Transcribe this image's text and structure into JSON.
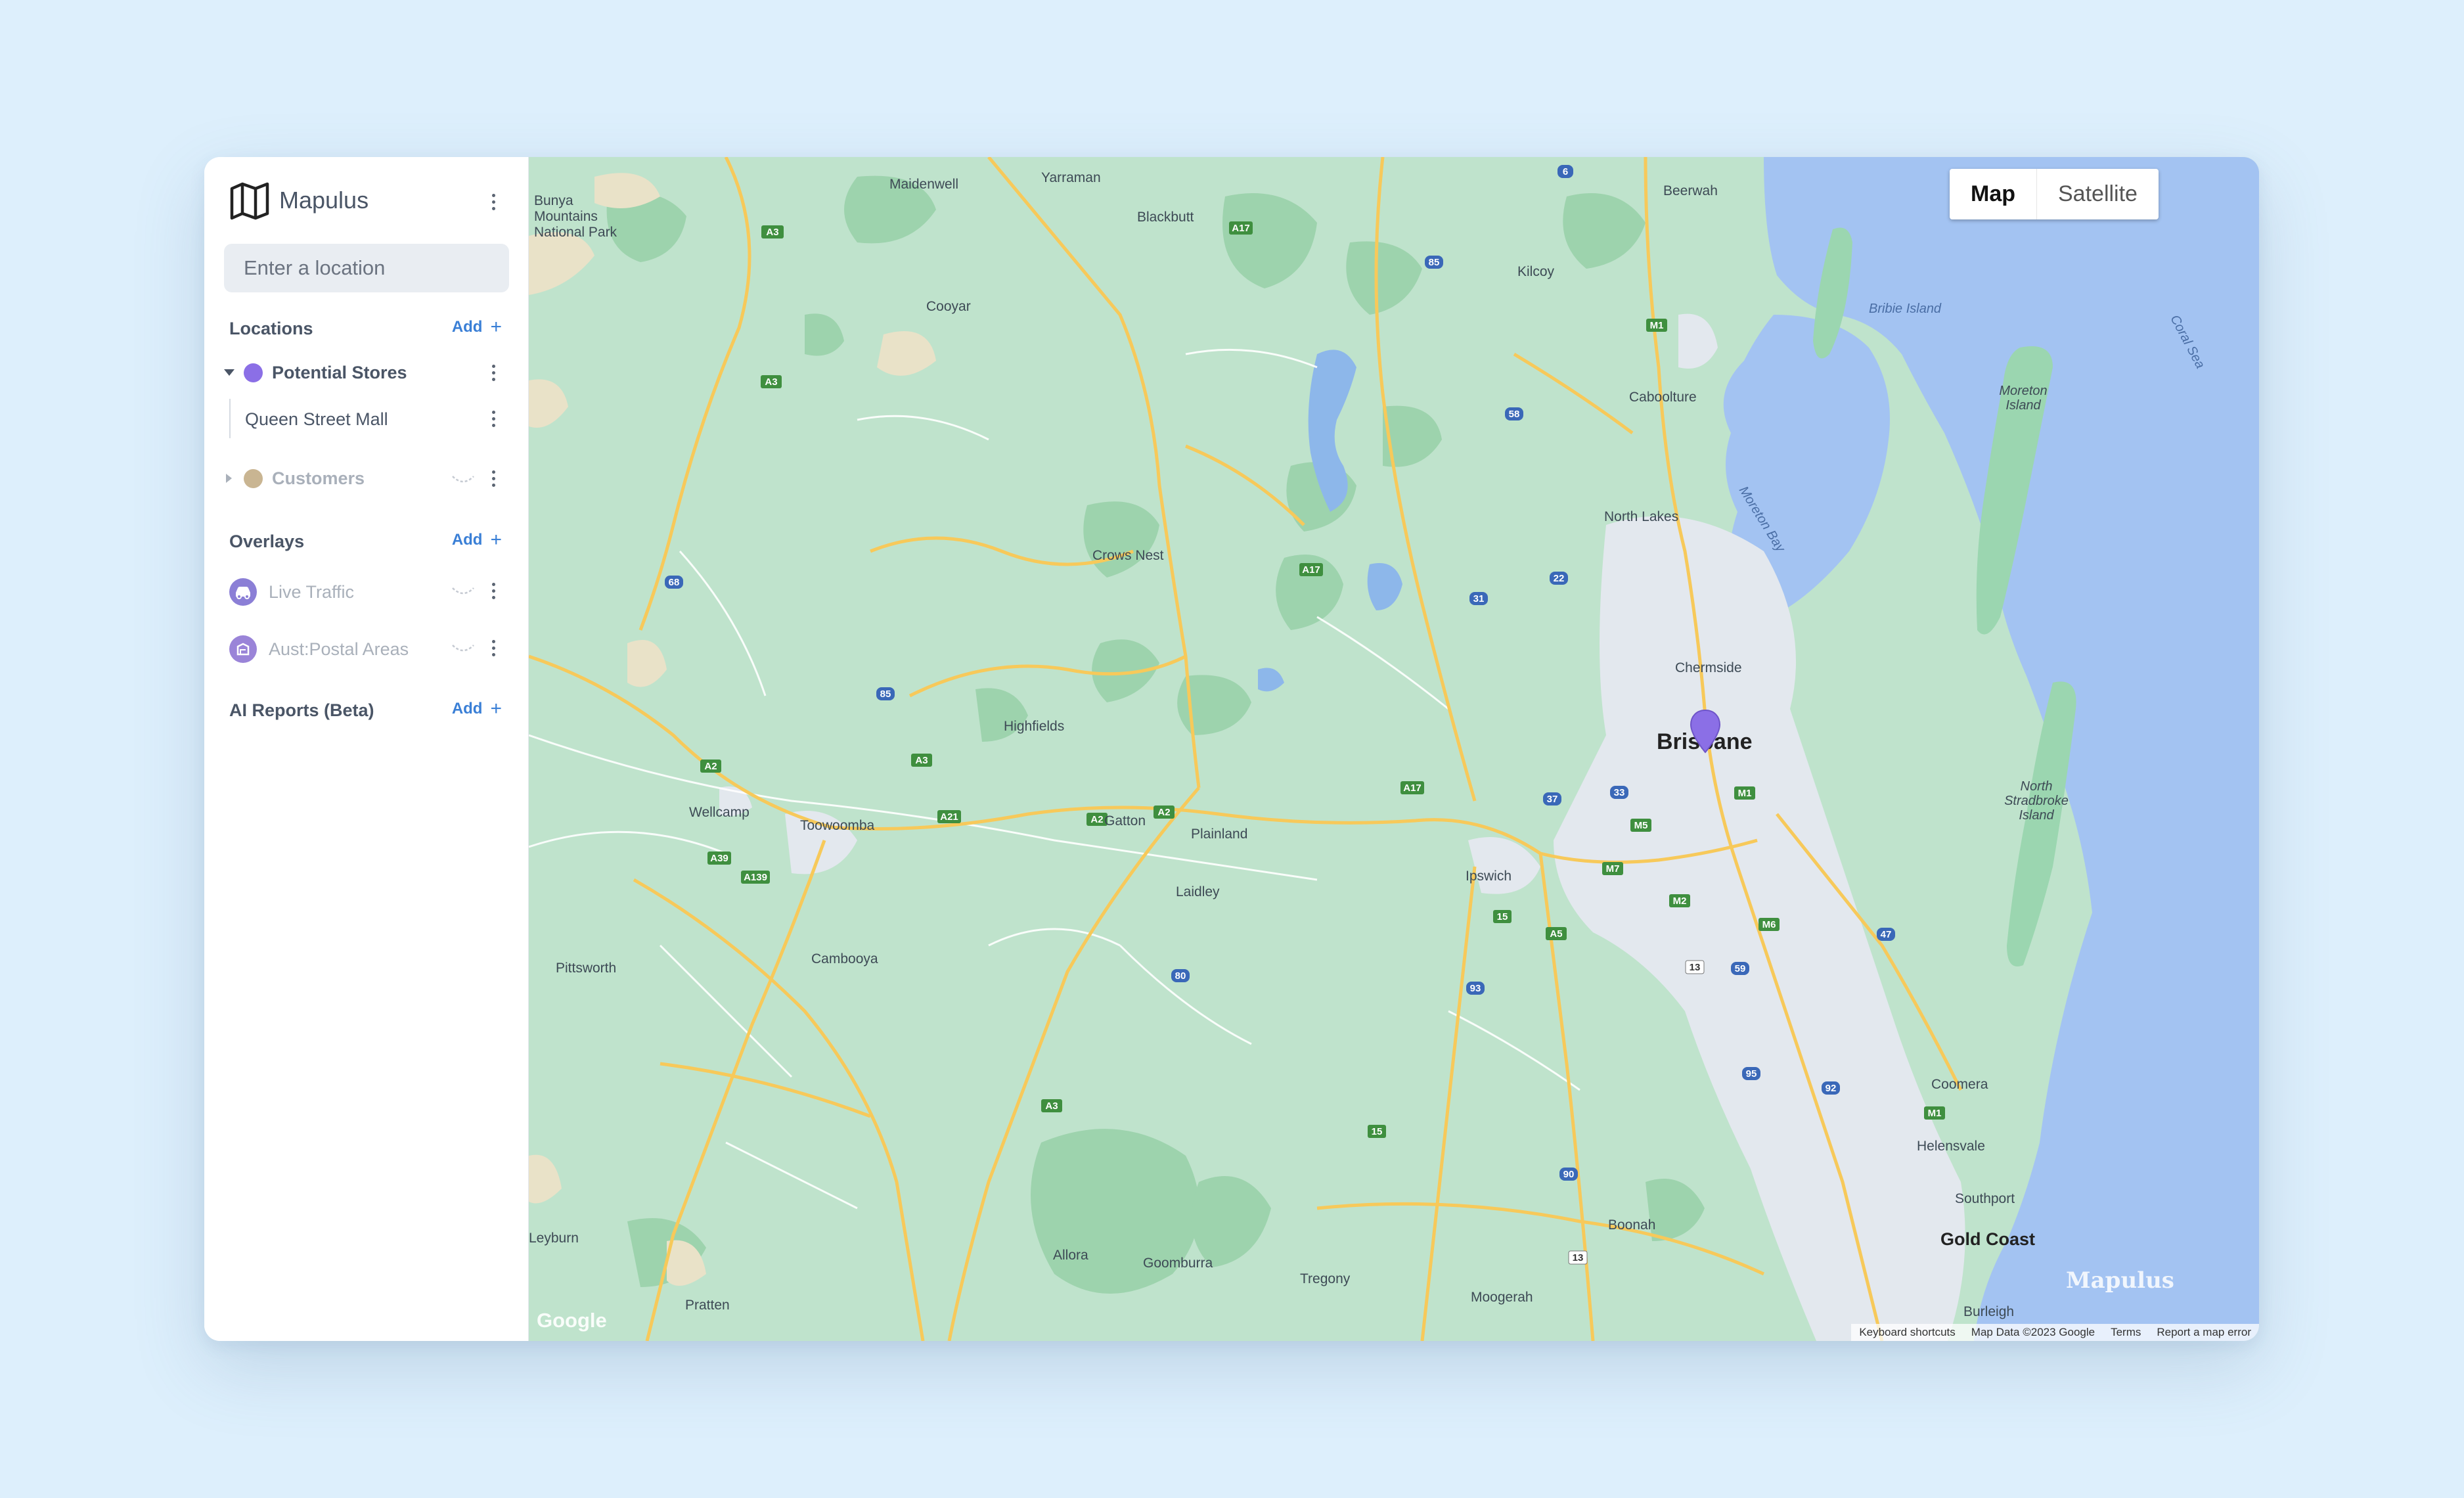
{
  "app": {
    "name": "Mapulus"
  },
  "search": {
    "placeholder": "Enter a location",
    "value": ""
  },
  "sections": {
    "locations": {
      "title": "Locations",
      "add_label": "Add"
    },
    "overlays": {
      "title": "Overlays",
      "add_label": "Add"
    },
    "ai_reports": {
      "title": "AI Reports (Beta)",
      "add_label": "Add"
    }
  },
  "locations": [
    {
      "name": "Potential Stores",
      "color": "#8b6fe6",
      "expanded": true,
      "children": [
        "Queen Street Mall"
      ]
    },
    {
      "name": "Customers",
      "color": "#c9b592",
      "expanded": false,
      "children": []
    }
  ],
  "overlays": [
    {
      "name": "Live Traffic",
      "icon": "car-icon"
    },
    {
      "name": "Aust:Postal Areas",
      "icon": "polygon-icon"
    }
  ],
  "map": {
    "type_options": [
      "Map",
      "Satellite"
    ],
    "selected_type": "Map",
    "watermark": "Mapulus",
    "google_logo": "Google",
    "attribution": [
      "Keyboard shortcuts",
      "Map Data ©2023 Google",
      "Terms",
      "Report a map error"
    ],
    "marker_color": "#8b6fe6",
    "places": {
      "maidenwell": "Maidenwell",
      "yarraman": "Yarraman",
      "blackbutt": "Blackbutt",
      "kilcoy": "Kilcoy",
      "beerwah": "Beerwah",
      "bribie": "Bribie Island",
      "coral_sea": "Coral Sea",
      "bunya": "Bunya Mountains National Park",
      "cooyar": "Cooyar",
      "caboolture": "Caboolture",
      "moreton_island": "Moreton Island",
      "moreton_bay": "Moreton Bay",
      "north_lakes": "North Lakes",
      "crows_nest": "Crows Nest",
      "chermside": "Chermside",
      "brisbane": "Brisbane",
      "highfields": "Highfields",
      "north_stradbroke": "North Stradbroke Island",
      "wellcamp": "Wellcamp",
      "toowoomba": "Toowoomba",
      "gatton": "Gatton",
      "plainland": "Plainland",
      "ipswich": "Ipswich",
      "laidley": "Laidley",
      "pittsworth": "Pittsworth",
      "cambooya": "Cambooya",
      "coomera": "Coomera",
      "helensvale": "Helensvale",
      "southport": "Southport",
      "gold_coast": "Gold Coast",
      "boonah": "Boonah",
      "allora": "Allora",
      "goomburra": "Goomburra",
      "tregony": "Tregony",
      "moogerah": "Moogerah",
      "burleigh": "Burleigh",
      "leyburn": "Leyburn",
      "pratten": "Pratten"
    },
    "road_shields": [
      "A3",
      "A17",
      "85",
      "6",
      "M1",
      "58",
      "A17",
      "31",
      "22",
      "68",
      "85",
      "A2",
      "A21",
      "A2",
      "A17",
      "37",
      "33",
      "M5",
      "M1",
      "M7",
      "M2",
      "M6",
      "A39",
      "A139",
      "A3",
      "A5",
      "15",
      "13",
      "59",
      "47",
      "80",
      "93",
      "95",
      "92",
      "M1",
      "15",
      "90",
      "13",
      "A3",
      "A2",
      "A3"
    ]
  }
}
